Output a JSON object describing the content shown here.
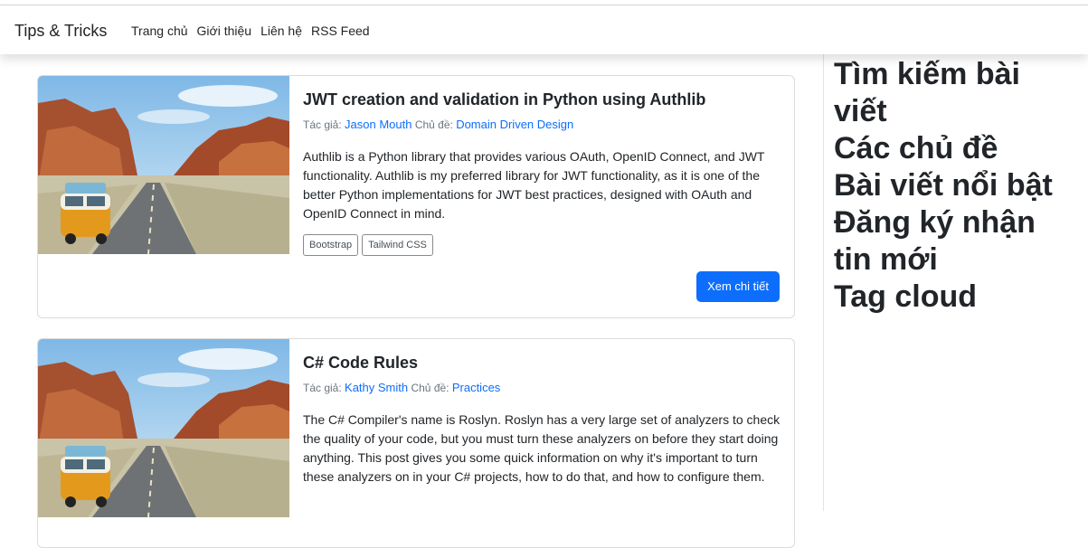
{
  "nav": {
    "brand": "Tips & Tricks",
    "links": [
      "Trang chủ",
      "Giới thiệu",
      "Liên hệ",
      "RSS Feed"
    ]
  },
  "posts": [
    {
      "title": "JWT creation and validation in Python using Authlib",
      "author_label": "Tác giả:",
      "author": "Jason Mouth",
      "topic_label": "Chủ đề:",
      "topic": "Domain Driven Design",
      "excerpt": "Authlib is a Python library that provides various OAuth, OpenID Connect, and JWT functionality. Authlib is my preferred library for JWT functionality, as it is one of the better Python implementations for JWT best practices, designed with OAuth and OpenID Connect in mind.",
      "tags": [
        "Bootstrap",
        "Tailwind CSS"
      ],
      "button": "Xem chi tiết"
    },
    {
      "title": "C# Code Rules",
      "author_label": "Tác giả:",
      "author": "Kathy Smith",
      "topic_label": "Chủ đề:",
      "topic": "Practices",
      "excerpt": "The C# Compiler's name is Roslyn. Roslyn has a very large set of analyzers to check the quality of your code, but you must turn these analyzers on before they start doing anything. This post gives you some quick information on why it's important to turn these analyzers on in your C# projects, how to do that, and how to configure them."
    }
  ],
  "sidebar": {
    "sections": [
      "Tìm kiếm bài viết",
      "Các chủ đề",
      "Bài viết nổi bật",
      "Đăng ký nhận tin mới",
      "Tag cloud"
    ]
  },
  "colors": {
    "link": "#0d6efd",
    "button": "#0d6efd",
    "text": "#212529",
    "muted": "#6c757d"
  }
}
